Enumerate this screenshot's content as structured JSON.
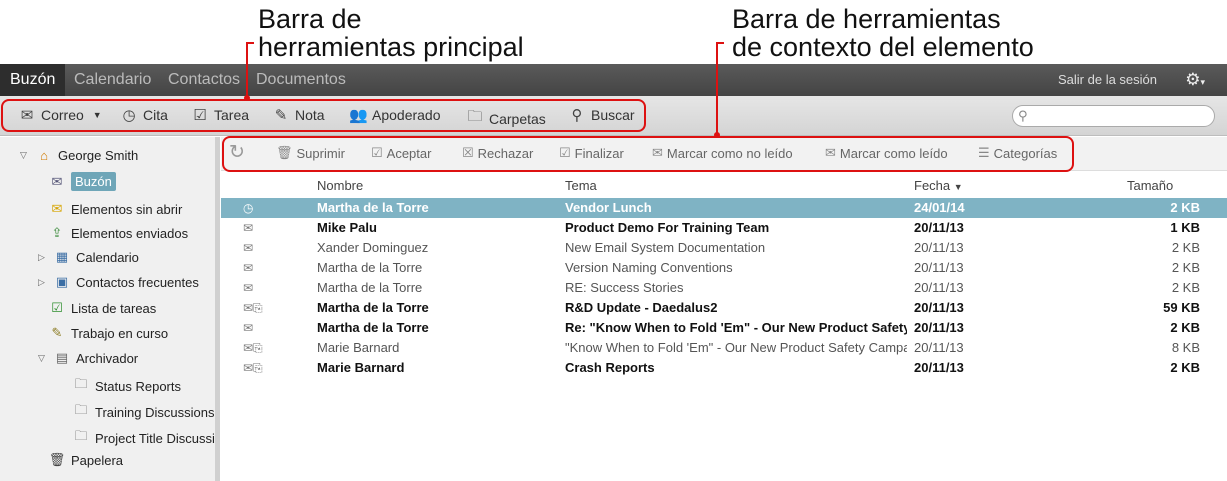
{
  "callouts": {
    "main_toolbar": [
      "Barra de",
      "herramientas principal"
    ],
    "context_toolbar": [
      "Barra de herramientas",
      "de contexto del elemento"
    ]
  },
  "nav": {
    "tabs": [
      "Buzón",
      "Calendario",
      "Contactos",
      "Documentos"
    ],
    "active_tab": "Buzón",
    "logout": "Salir de la sesión",
    "settings_icon": "gear-icon"
  },
  "toolbar": {
    "mail": "Correo",
    "appointment": "Cita",
    "task": "Tarea",
    "note": "Nota",
    "proxy": "Apoderado",
    "folders": "Carpetas",
    "find": "Buscar",
    "search_placeholder": ""
  },
  "context_toolbar": {
    "delete": "Suprimir",
    "accept": "Aceptar",
    "decline": "Rechazar",
    "complete": "Finalizar",
    "mark_unread": "Marcar como no leído",
    "mark_read": "Marcar como leído",
    "categories": "Categorías"
  },
  "sidebar": {
    "user": "George Smith",
    "items": [
      {
        "label": "Buzón",
        "icon": "mailbox-icon"
      },
      {
        "label": "Elementos sin abrir",
        "icon": "envelope-icon"
      },
      {
        "label": "Elementos enviados",
        "icon": "sent-icon"
      },
      {
        "label": "Calendario",
        "icon": "calendar-icon"
      },
      {
        "label": "Contactos frecuentes",
        "icon": "contacts-icon"
      },
      {
        "label": "Lista de tareas",
        "icon": "checklist-icon"
      },
      {
        "label": "Trabajo en curso",
        "icon": "pencil-icon"
      },
      {
        "label": "Archivador",
        "icon": "cabinet-icon"
      },
      {
        "label": "Status Reports",
        "icon": "folder-icon"
      },
      {
        "label": "Training Discussions",
        "icon": "folder-icon"
      },
      {
        "label": "Project Title Discussi",
        "icon": "folder-icon"
      },
      {
        "label": "Papelera",
        "icon": "trash-icon"
      }
    ]
  },
  "list": {
    "headers": {
      "name": "Nombre",
      "subject": "Tema",
      "date": "Fecha",
      "size": "Tamaño"
    },
    "rows": [
      {
        "icon": "clock-icon",
        "name": "Martha de la Torre",
        "subject": "Vendor Lunch",
        "date": "24/01/14",
        "size": "2 KB"
      },
      {
        "icon": "envelope-icon",
        "name": "Mike Palu",
        "subject": "Product Demo For Training Team",
        "date": "20/11/13",
        "size": "1 KB"
      },
      {
        "icon": "envelope-open-icon",
        "name": "Xander Dominguez",
        "subject": "New Email System Documentation",
        "date": "20/11/13",
        "size": "2 KB"
      },
      {
        "icon": "envelope-open-icon",
        "name": "Martha de la Torre",
        "subject": "Version Naming Conventions",
        "date": "20/11/13",
        "size": "2 KB"
      },
      {
        "icon": "envelope-open-icon",
        "name": "Martha de la Torre",
        "subject": "RE: Success Stories",
        "date": "20/11/13",
        "size": "2 KB"
      },
      {
        "icon": "envelope-attachment-icon",
        "name": "Martha de la Torre",
        "subject": "R&D Update - Daedalus2",
        "date": "20/11/13",
        "size": "59 KB"
      },
      {
        "icon": "envelope-icon",
        "name": "Martha de la Torre",
        "subject": "Re: \"Know When to Fold 'Em\" - Our New Product Safety",
        "date": "20/11/13",
        "size": "2 KB"
      },
      {
        "icon": "envelope-open-attachment-icon",
        "name": "Marie Barnard",
        "subject": "\"Know When to Fold 'Em\" - Our New Product Safety Campa",
        "date": "20/11/13",
        "size": "8 KB"
      },
      {
        "icon": "envelope-attachment-icon",
        "name": "Marie Barnard",
        "subject": "Crash Reports",
        "date": "20/11/13",
        "size": "2 KB"
      }
    ]
  }
}
